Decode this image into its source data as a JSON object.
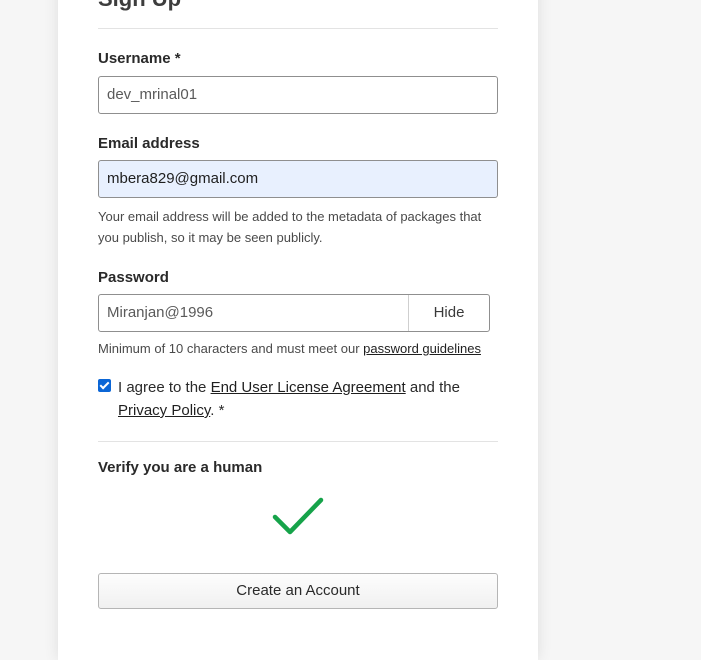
{
  "form": {
    "title": "Sign Up",
    "username": {
      "label": "Username *",
      "value": "dev_mrinal01"
    },
    "email": {
      "label": "Email address",
      "value": "mbera829@gmail.com",
      "help": "Your email address will be added to the metadata of packages that you publish, so it may be seen publicly."
    },
    "password": {
      "label": "Password",
      "value": "Miranjan@1996",
      "toggle_label": "Hide",
      "help_prefix": "Minimum of 10 characters and must meet our ",
      "help_link": "password guidelines"
    },
    "agreement": {
      "checked": true,
      "prefix": "I agree to the ",
      "eula_link": "End User License Agreement",
      "middle": " and the ",
      "privacy_link": "Privacy Policy",
      "suffix": ". *"
    },
    "captcha": {
      "label": "Verify you are a human",
      "icon": "checkmark-icon",
      "color": "#16a34a"
    },
    "submit_label": "Create an Account"
  },
  "colors": {
    "checkbox": "#0b66d6",
    "autofill": "#e8f0fe"
  }
}
